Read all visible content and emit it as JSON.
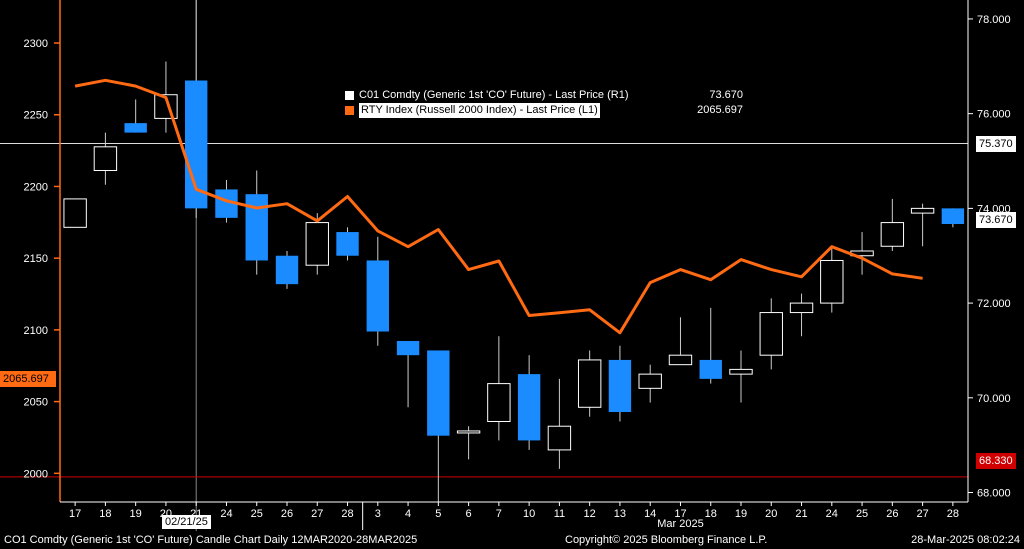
{
  "legend": [
    {
      "swatch": "#ffffff",
      "label": "C01 Comdty (Generic 1st 'CO' Future) - Last Price  (R1)",
      "value": "73.670"
    },
    {
      "swatch": "#ff6a13",
      "label": "RTY Index (Russell 2000 Index) - Last Price  (L1)",
      "value": "2065.697"
    }
  ],
  "flags": {
    "left_last": "2065.697",
    "right_hline": "75.370",
    "right_last": "73.670",
    "right_low": "68.330",
    "crosshair_date": "02/21/25"
  },
  "footer": {
    "left": "CO1 Comdty (Generic 1st 'CO' Future) Candle Chart  Daily 12MAR2020-28MAR2025",
    "center": "Copyright© 2025 Bloomberg Finance L.P.",
    "right": "28-Mar-2025 08:02:24"
  },
  "colors": {
    "up_candle": "#ffffff",
    "down_candle": "#1a8cff",
    "line": "#ff6a13",
    "left_axis": "#ff6a13",
    "low_line": "#d00000"
  },
  "chart_data": {
    "type": "candlestick+line",
    "x": [
      "17",
      "18",
      "19",
      "20",
      "21",
      "24",
      "25",
      "26",
      "27",
      "28",
      "3",
      "4",
      "5",
      "6",
      "7",
      "10",
      "11",
      "12",
      "13",
      "14",
      "17",
      "18",
      "19",
      "20",
      "21",
      "24",
      "25",
      "26",
      "27",
      "28"
    ],
    "month_label": "Mar 2025",
    "left_axis": {
      "ticks": [
        2000,
        2050,
        2100,
        2150,
        2200,
        2250,
        2300
      ],
      "range": [
        1980,
        2330
      ]
    },
    "right_axis": {
      "ticks": [
        "68.000",
        "70.000",
        "72.000",
        "74.000",
        "76.000",
        "78.000"
      ],
      "range": [
        67.8,
        78.4
      ]
    },
    "candles": [
      {
        "o": 73.6,
        "h": 74.0,
        "l": 73.8,
        "c": 74.2
      },
      {
        "o": 74.8,
        "h": 75.6,
        "l": 74.5,
        "c": 75.3
      },
      {
        "o": 75.8,
        "h": 76.3,
        "l": 75.6,
        "c": 75.6
      },
      {
        "o": 75.9,
        "h": 77.1,
        "l": 75.6,
        "c": 76.4
      },
      {
        "o": 76.7,
        "h": 78.4,
        "l": 73.8,
        "c": 74.0
      },
      {
        "o": 74.4,
        "h": 74.6,
        "l": 73.7,
        "c": 73.8
      },
      {
        "o": 74.3,
        "h": 74.8,
        "l": 72.6,
        "c": 72.9
      },
      {
        "o": 73.0,
        "h": 73.1,
        "l": 72.3,
        "c": 72.4
      },
      {
        "o": 72.8,
        "h": 73.9,
        "l": 72.6,
        "c": 73.7
      },
      {
        "o": 73.5,
        "h": 73.6,
        "l": 72.9,
        "c": 73.0
      },
      {
        "o": 72.9,
        "h": 73.4,
        "l": 71.1,
        "c": 71.4
      },
      {
        "o": 71.2,
        "h": 71.2,
        "l": 69.8,
        "c": 70.9
      },
      {
        "o": 71.0,
        "h": 71.0,
        "l": 67.8,
        "c": 69.2
      },
      {
        "o": 69.3,
        "h": 69.4,
        "l": 68.7,
        "c": 69.3
      },
      {
        "o": 69.5,
        "h": 71.3,
        "l": 69.1,
        "c": 70.3
      },
      {
        "o": 70.5,
        "h": 70.9,
        "l": 68.9,
        "c": 69.1
      },
      {
        "o": 68.9,
        "h": 70.4,
        "l": 68.5,
        "c": 69.4
      },
      {
        "o": 69.8,
        "h": 71.0,
        "l": 69.6,
        "c": 70.8
      },
      {
        "o": 70.8,
        "h": 71.1,
        "l": 69.5,
        "c": 69.7
      },
      {
        "o": 70.2,
        "h": 70.7,
        "l": 69.9,
        "c": 70.5
      },
      {
        "o": 70.7,
        "h": 71.7,
        "l": 70.7,
        "c": 70.9
      },
      {
        "o": 70.8,
        "h": 71.9,
        "l": 70.3,
        "c": 70.4
      },
      {
        "o": 70.5,
        "h": 71.0,
        "l": 69.9,
        "c": 70.6
      },
      {
        "o": 70.9,
        "h": 72.1,
        "l": 70.6,
        "c": 71.8
      },
      {
        "o": 71.8,
        "h": 72.2,
        "l": 71.3,
        "c": 72.0
      },
      {
        "o": 72.0,
        "h": 73.2,
        "l": 71.8,
        "c": 72.9
      },
      {
        "o": 73.0,
        "h": 73.5,
        "l": 72.6,
        "c": 73.1
      },
      {
        "o": 73.2,
        "h": 74.2,
        "l": 73.1,
        "c": 73.7
      },
      {
        "o": 73.9,
        "h": 74.1,
        "l": 73.2,
        "c": 74.0
      },
      {
        "o": 74.0,
        "h": 74.0,
        "l": 73.6,
        "c": 73.67
      }
    ],
    "series": [
      {
        "name": "RTY Index (Russell 2000 Index) - Last Price  (L1)",
        "values": [
          2270,
          2274,
          2270,
          2262,
          2198,
          2190,
          2185,
          2188,
          2176,
          2193,
          2169,
          2158,
          2170,
          2142,
          2148,
          2110,
          2112,
          2114,
          2098,
          2133,
          2142,
          2135,
          2149,
          2142,
          2137,
          2158,
          2150,
          2139,
          2136,
          null
        ]
      }
    ],
    "hlines": [
      {
        "axis": "right",
        "value": 75.37
      },
      {
        "axis": "right",
        "value": 68.33
      }
    ],
    "crosshair_index": 4
  }
}
